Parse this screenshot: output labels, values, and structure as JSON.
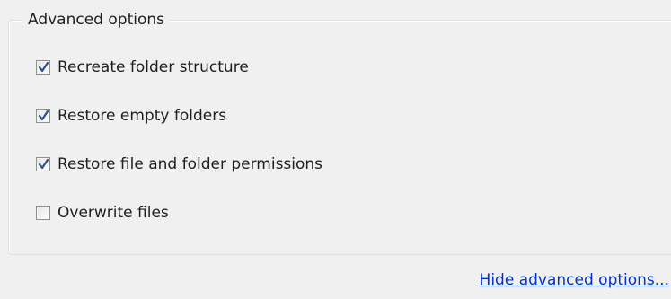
{
  "group": {
    "title": "Advanced options"
  },
  "options": [
    {
      "label": "Recreate folder structure",
      "checked": true
    },
    {
      "label": "Restore empty folders",
      "checked": true
    },
    {
      "label": "Restore file and folder permissions",
      "checked": true
    },
    {
      "label": "Overwrite files",
      "checked": false
    }
  ],
  "footer": {
    "hide_link_label": "Hide advanced options..."
  },
  "colors": {
    "background": "#f0f0f0",
    "link": "#0033cc",
    "check": "#2b4f8f"
  }
}
